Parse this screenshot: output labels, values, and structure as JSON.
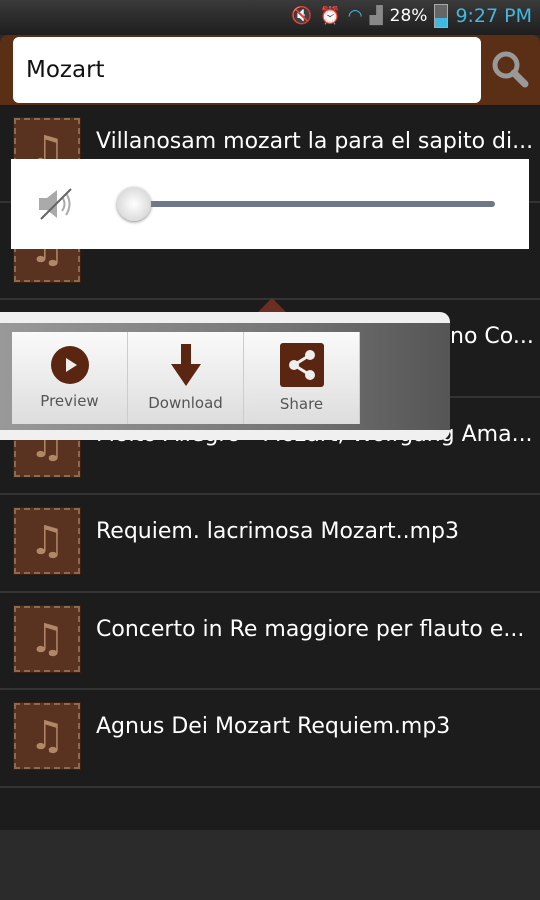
{
  "status_bar": {
    "battery": "28%",
    "time": "9:27 PM",
    "icons": [
      "mute-icon",
      "alarm-icon",
      "wifi-icon",
      "signal-icon",
      "battery-icon"
    ]
  },
  "search": {
    "value": "Mozart",
    "button_icon": "search-icon"
  },
  "list": [
    {
      "title": "Villanosam mozart la para el sapito di..."
    },
    {
      "title": ""
    },
    {
      "title": "no Co..."
    },
    {
      "title": "Molto Allegro - Mozart, Wolfgang Ama..."
    },
    {
      "title": "Requiem. lacrimosa   Mozart..mp3"
    },
    {
      "title": "Concerto in Re maggiore per flauto e..."
    },
    {
      "title": "Agnus Dei   Mozart   Requiem.mp3"
    }
  ],
  "volume": {
    "level": 0,
    "icon": "muted-speaker-icon"
  },
  "quick_actions": [
    {
      "label": "Preview",
      "icon": "play-icon"
    },
    {
      "label": "Download",
      "icon": "download-arrow-icon"
    },
    {
      "label": "Share",
      "icon": "share-icon"
    }
  ],
  "colors": {
    "brand": "#5b2e16",
    "accent": "#41b8e0"
  }
}
